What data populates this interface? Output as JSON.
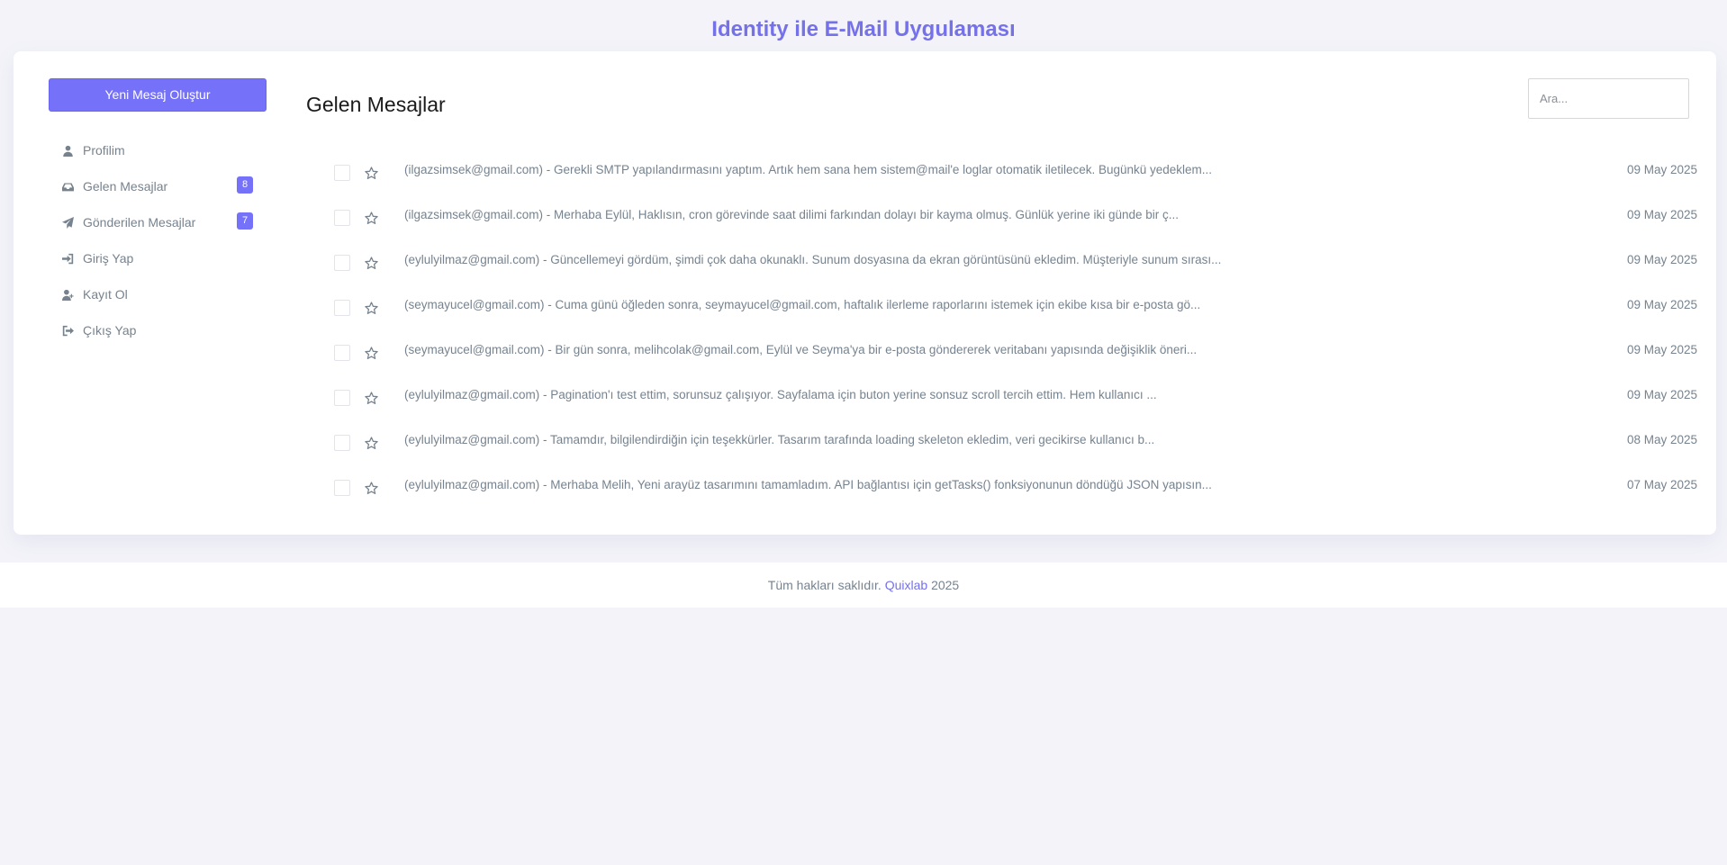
{
  "header": {
    "title": "Identity ile E-Mail Uygulaması"
  },
  "sidebar": {
    "compose_label": "Yeni Mesaj Oluştur",
    "items": [
      {
        "label": "Profilim",
        "icon": "user-icon"
      },
      {
        "label": "Gelen Mesajlar",
        "icon": "inbox-icon",
        "badge": "8"
      },
      {
        "label": "Gönderilen Mesajlar",
        "icon": "paper-plane-icon",
        "badge": "7"
      },
      {
        "label": "Giriş Yap",
        "icon": "sign-in-icon"
      },
      {
        "label": "Kayıt Ol",
        "icon": "user-plus-icon"
      },
      {
        "label": "Çıkış Yap",
        "icon": "sign-out-icon"
      }
    ]
  },
  "main": {
    "title": "Gelen Mesajlar",
    "search_placeholder": "Ara...",
    "messages": [
      {
        "text": "(ilgazsimsek@gmail.com) - Gerekli SMTP yapılandırmasını yaptım. Artık hem sana hem sistem@mail'e loglar otomatik iletilecek. Bugünkü yedeklem...",
        "date": "09 May 2025"
      },
      {
        "text": "(ilgazsimsek@gmail.com) - Merhaba Eylül, Haklısın, cron görevinde saat dilimi farkından dolayı bir kayma olmuş. Günlük yerine iki günde bir ç...",
        "date": "09 May 2025"
      },
      {
        "text": "(eylulyilmaz@gmail.com) - Güncellemeyi gördüm, şimdi çok daha okunaklı. Sunum dosyasına da ekran görüntüsünü ekledim. Müşteriyle sunum sırası...",
        "date": "09 May 2025"
      },
      {
        "text": "(seymayucel@gmail.com) - Cuma günü öğleden sonra, seymayucel@gmail.com, haftalık ilerleme raporlarını istemek için ekibe kısa bir e-posta gö...",
        "date": "09 May 2025"
      },
      {
        "text": "(seymayucel@gmail.com) - Bir gün sonra, melihcolak@gmail.com, Eylül ve Seyma'ya bir e-posta göndererek veritabanı yapısında değişiklik öneri...",
        "date": "09 May 2025"
      },
      {
        "text": "(eylulyilmaz@gmail.com) - Pagination'ı test ettim, sorunsuz çalışıyor. Sayfalama için buton yerine sonsuz scroll tercih ettim. Hem kullanıcı ...",
        "date": "09 May 2025"
      },
      {
        "text": "(eylulyilmaz@gmail.com) - Tamamdır, bilgilendirdiğin için teşekkürler. Tasarım tarafında loading skeleton ekledim, veri gecikirse kullanıcı b...",
        "date": "08 May 2025"
      },
      {
        "text": "(eylulyilmaz@gmail.com) - Merhaba Melih, Yeni arayüz tasarımını tamamladım. API bağlantısı için getTasks() fonksiyonunun döndüğü JSON yapısın...",
        "date": "07 May 2025"
      }
    ]
  },
  "footer": {
    "prefix": "Tüm hakları saklıdır.",
    "brand": "Quixlab",
    "year": "2025"
  },
  "colors": {
    "accent": "#7571f9",
    "background": "#f3f3f9",
    "text": "#76838f"
  }
}
